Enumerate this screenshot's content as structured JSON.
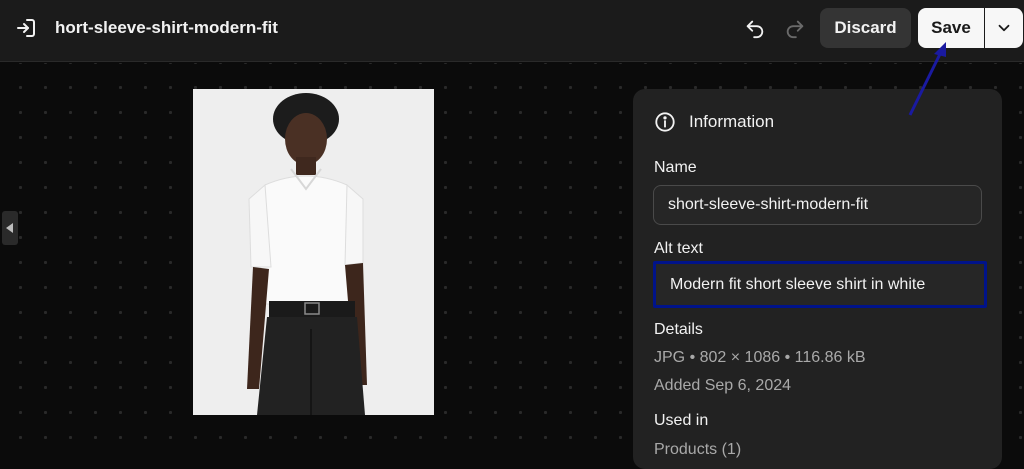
{
  "header": {
    "title": "hort-sleeve-shirt-modern-fit",
    "discard_label": "Discard",
    "save_label": "Save",
    "icons": [
      "exit-icon",
      "undo-icon",
      "redo-icon",
      "chevron-down-icon"
    ]
  },
  "preview": {
    "image_alt": "Modern fit short sleeve shirt in white"
  },
  "panel": {
    "heading": "Information",
    "name_label": "Name",
    "name_value": "short-sleeve-shirt-modern-fit",
    "alt_label": "Alt text",
    "alt_value": "Modern fit short sleeve shirt in white",
    "details_label": "Details",
    "details_line": "JPG • 802 × 1086 • 116.86 kB",
    "added_line": "Added Sep 6, 2024",
    "used_in_label": "Used in",
    "used_in_value": "Products (1)"
  },
  "colors": {
    "background": "#0b0b0b",
    "panel": "#222222",
    "focus_outline": "#00138a",
    "annotation_arrow": "#1a1aa0"
  }
}
